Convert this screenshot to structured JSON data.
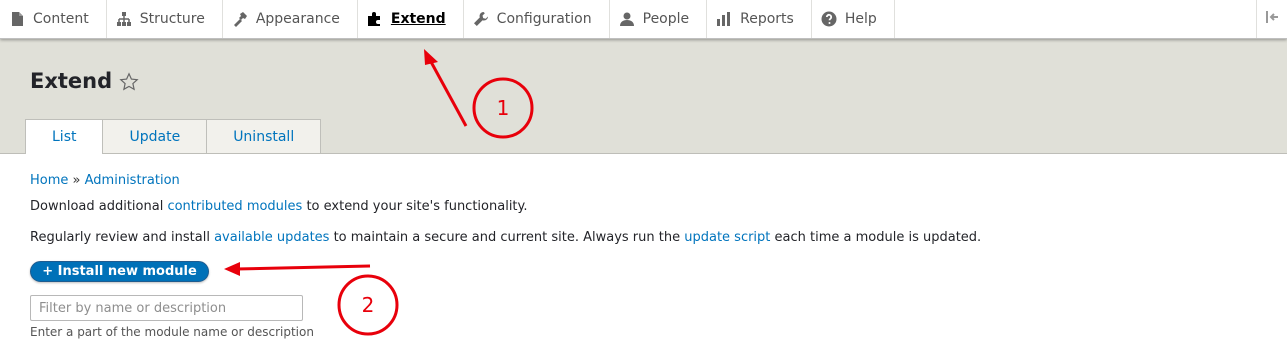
{
  "toolbar": {
    "items": [
      {
        "label": "Content",
        "icon": "content-icon"
      },
      {
        "label": "Structure",
        "icon": "structure-icon"
      },
      {
        "label": "Appearance",
        "icon": "appearance-icon"
      },
      {
        "label": "Extend",
        "icon": "extend-icon",
        "active": true
      },
      {
        "label": "Configuration",
        "icon": "wrench-icon"
      },
      {
        "label": "People",
        "icon": "people-icon"
      },
      {
        "label": "Reports",
        "icon": "reports-icon"
      },
      {
        "label": "Help",
        "icon": "help-icon"
      }
    ],
    "collapse_icon": "collapse-tray-icon"
  },
  "header": {
    "title": "Extend",
    "shortcut_icon": "star-icon",
    "tabs": [
      {
        "label": "List",
        "active": true
      },
      {
        "label": "Update"
      },
      {
        "label": "Uninstall"
      }
    ]
  },
  "breadcrumb": {
    "home": "Home",
    "separator": "»",
    "current": "Administration"
  },
  "intro": {
    "line1_before": "Download additional ",
    "line1_link": "contributed modules",
    "line1_after": " to extend your site's functionality.",
    "line2_before": "Regularly review and install ",
    "line2_link1": "available updates",
    "line2_middle": " to maintain a secure and current site. Always run the ",
    "line2_link2": "update script",
    "line2_after": " each time a module is updated."
  },
  "install_button": {
    "label": "+ Install new module"
  },
  "filter": {
    "placeholder": "Filter by name or description",
    "value": "",
    "help": "Enter a part of the module name or description"
  },
  "annotations": {
    "marker1": "1",
    "marker2": "2",
    "color": "#e8000b"
  },
  "colors": {
    "link": "#0074bd",
    "button": "#0071b8",
    "header_bg": "#e0e0d8"
  }
}
